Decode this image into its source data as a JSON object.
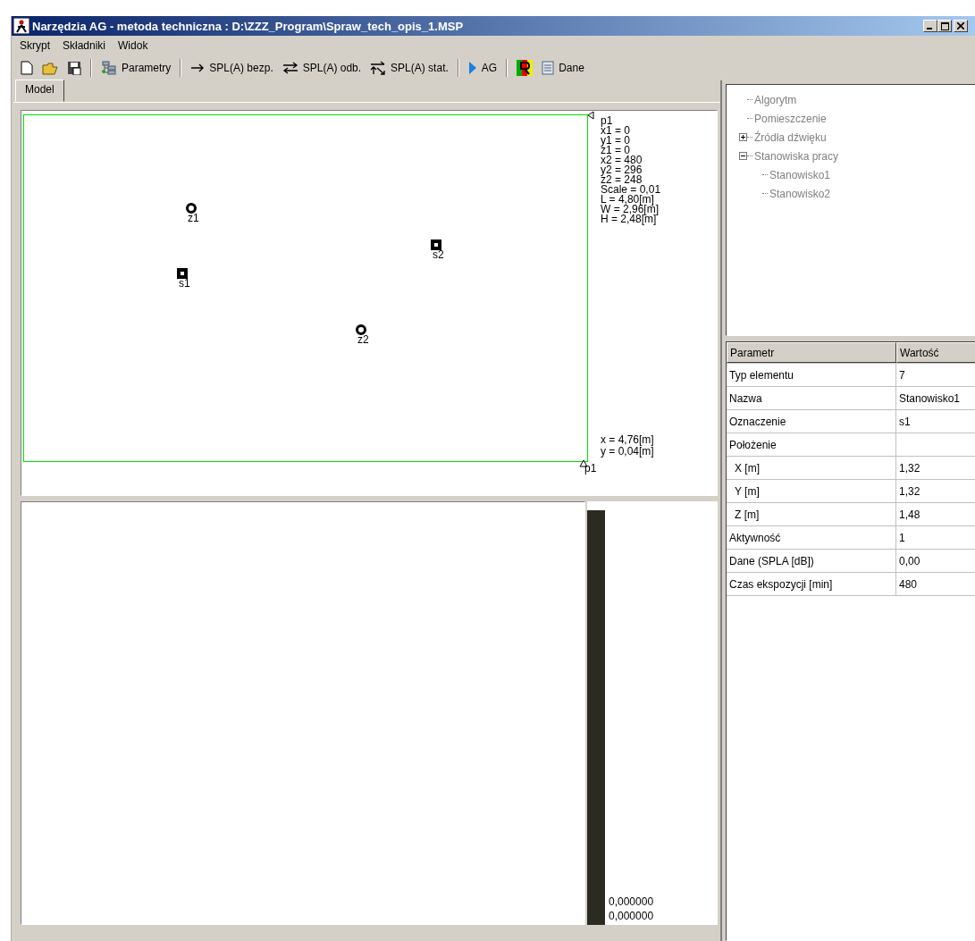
{
  "window": {
    "title": "Narzędzia AG - metoda techniczna : D:\\ZZZ_Program\\Spraw_tech_opis_1.MSP"
  },
  "menu": [
    "Skrypt",
    "Składniki",
    "Widok"
  ],
  "toolbar": [
    {
      "kind": "new"
    },
    {
      "kind": "open"
    },
    {
      "kind": "save"
    },
    {
      "kind": "separator"
    },
    {
      "kind": "params",
      "label": "Parametry"
    },
    {
      "kind": "separator"
    },
    {
      "kind": "arrow",
      "label": "SPL(A) bezp."
    },
    {
      "kind": "swap",
      "label": "SPL(A) odb."
    },
    {
      "kind": "stat",
      "label": "SPL(A) stat."
    },
    {
      "kind": "separator"
    },
    {
      "kind": "play",
      "label": "AG"
    },
    {
      "kind": "separator"
    },
    {
      "kind": "report"
    },
    {
      "kind": "doc",
      "label": "Dane"
    }
  ],
  "tabs": [
    {
      "label": "Model",
      "selected": true
    }
  ],
  "canvas": {
    "info_label": "p1",
    "info": [
      "x1 = 0",
      "y1 = 0",
      "z1 = 0",
      "x2 = 480",
      "y2 = 296",
      "z2 = 248",
      "Scale = 0,01",
      "L = 4,80[m]",
      "W = 2,96[m]",
      "H = 2,48[m]"
    ],
    "cursor": [
      "x = 4,76[m]",
      "y = 0,04[m]"
    ],
    "corner_label": "p1",
    "markers": [
      {
        "kind": "source",
        "label": "z1"
      },
      {
        "kind": "station",
        "label": "s1"
      },
      {
        "kind": "station",
        "label": "s2"
      },
      {
        "kind": "source",
        "label": "z2"
      }
    ]
  },
  "scale_values": [
    "0,000000",
    "0,000000"
  ],
  "tree": [
    {
      "label": "Algorytm"
    },
    {
      "label": "Pomieszczenie"
    },
    {
      "label": "Źródła dźwięku",
      "expanded": false
    },
    {
      "label": "Stanowiska pracy",
      "expanded": true,
      "children": [
        {
          "label": "Stanowisko1"
        },
        {
          "label": "Stanowisko2"
        }
      ]
    }
  ],
  "table": {
    "columns": [
      "Parametr",
      "Wartość"
    ],
    "rows": [
      {
        "param": "Typ elementu",
        "value": "7"
      },
      {
        "param": "Nazwa",
        "value": "Stanowisko1"
      },
      {
        "param": "Oznaczenie",
        "value": "s1"
      },
      {
        "param": "Położenie",
        "value": ""
      },
      {
        "param": "X [m]",
        "value": "1,32",
        "indent": true
      },
      {
        "param": "Y [m]",
        "value": "1,32",
        "indent": true
      },
      {
        "param": "Z [m]",
        "value": "1,48",
        "indent": true
      },
      {
        "param": "Aktywność",
        "value": "1"
      },
      {
        "param": "Dane (SPLA [dB])",
        "value": "0,00"
      },
      {
        "param": "Czas ekspozycji [min]",
        "value": "480"
      }
    ]
  }
}
